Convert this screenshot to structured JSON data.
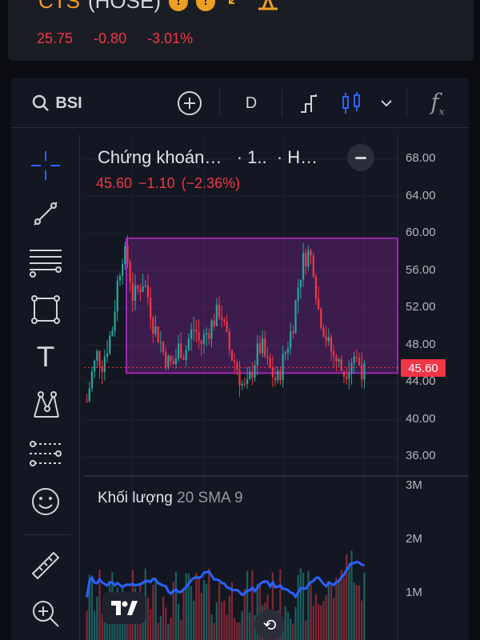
{
  "header": {
    "symbol": "CTS",
    "exchange": "(HOSE)",
    "price": "25.75",
    "change": "-0.80",
    "change_pct": "-3.01%"
  },
  "toolbar": {
    "symbol": "BSI",
    "interval": "D",
    "icons": [
      "search-icon",
      "add-symbol-icon",
      "bar-style-icon",
      "candles-icon",
      "chevron-down-icon",
      "indicators-icon"
    ]
  },
  "left_tools": [
    "crosshair-icon",
    "trend-line-icon",
    "fib-icon",
    "rectangle-icon",
    "text-icon",
    "pattern-icon",
    "prediction-icon",
    "emoji-icon",
    "ruler-icon",
    "zoom-in-icon"
  ],
  "legend": {
    "title": "Chứng khoán…",
    "interval": "· 1..",
    "exchange": "· H…",
    "close": "45.60",
    "change": "−1.10",
    "change_pct": "(−2.36%)"
  },
  "price_axis": [
    "68.00",
    "64.00",
    "60.00",
    "56.00",
    "52.00",
    "48.00",
    "44.00",
    "40.00",
    "36.00"
  ],
  "last_price": "45.60",
  "volume": {
    "title": "Khối lượng",
    "params": "20 SMA 9",
    "axis": [
      "3M",
      "2M",
      "1M"
    ]
  },
  "chart_data": {
    "type": "candlestick",
    "ylim": [
      34,
      70
    ],
    "last": 45.6,
    "zone": {
      "top": 59.5,
      "bottom": 45
    },
    "close_path": [
      42,
      45,
      47,
      46,
      48,
      50,
      55,
      58,
      57,
      53,
      54,
      55,
      53,
      50,
      49,
      47,
      46,
      46,
      48,
      47,
      49,
      50,
      48,
      49,
      50,
      51,
      52,
      49,
      47,
      46,
      44,
      43,
      45,
      47,
      48,
      46,
      45,
      44,
      46,
      48,
      50,
      54,
      57,
      58,
      57,
      52,
      50,
      48,
      47,
      46,
      45,
      46,
      47,
      46,
      45
    ]
  },
  "colors": {
    "up": "#26a69a",
    "down": "#f23645",
    "zone": "#9c27b0",
    "vol_ma": "#2962ff"
  }
}
